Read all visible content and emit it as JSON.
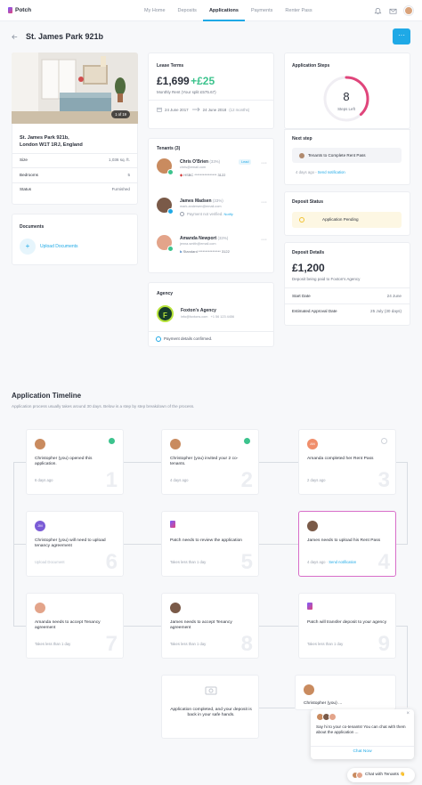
{
  "app": {
    "name": "Potch"
  },
  "nav": {
    "items": [
      "My Home",
      "Deposits",
      "Applications",
      "Payments",
      "Renter Pass"
    ],
    "active": "Applications"
  },
  "colors": {
    "accent": "#1fa9e6",
    "success": "#3cc38d",
    "highlight": "#d86ec9",
    "brand_gradient": [
      "#7b5cff",
      "#e0457b"
    ]
  },
  "page": {
    "back_icon": "arrow-left-icon",
    "title": "St. James Park 921b",
    "more_label": "···"
  },
  "property": {
    "photo_count": "1 of 19",
    "address_line1": "St. James Park 921b,",
    "address_line2": "London W1T 1RJ, England",
    "rows": [
      {
        "key": "Size",
        "value": "1,036 sq. ft."
      },
      {
        "key": "Bedrooms",
        "value": "5"
      },
      {
        "key": "Status",
        "value": "Furnished"
      }
    ]
  },
  "documents": {
    "title": "Documents",
    "upload_label": "Upload Documents",
    "plus": "+"
  },
  "lease": {
    "title": "Lease Terms",
    "rent": "£1,699",
    "share": "+£25",
    "rent_note": "Monthly Rent (Your split £575.67)",
    "start_date": "24 June 2017",
    "end_date": "24 June 2018",
    "end_suffix": "(12 months)"
  },
  "tenants": {
    "title": "Tenants (3)",
    "list": [
      {
        "name": "Chris O'Brien",
        "share": "(33%)",
        "badge": "Lead",
        "email": "chris@email.com",
        "bank": "HSBC **************** 3122"
      },
      {
        "name": "James Madsen",
        "share": "(33%)",
        "email": "mark.andersen@email.com",
        "bank_status": "Payment not verified.",
        "bank_action": "Notify"
      },
      {
        "name": "Amanda Newport",
        "share": "(33%)",
        "email": "jenna.smith@email.com",
        "bank": "Standard **************** 3122"
      }
    ]
  },
  "agency": {
    "title": "Agency",
    "logo_letter": "F",
    "name": "Foxton's Agency",
    "email": "info@foxtons.com",
    "phone": "+1 56 123 4456",
    "confirmed": "Payment details confirmed."
  },
  "steps": {
    "title": "Application Steps",
    "count": "8",
    "sub": "Steps Left",
    "progress": 0.38
  },
  "next_step": {
    "title": "Next step",
    "task": "Tenants to Complete Rent Pass",
    "ago": "4 days ago",
    "action": "Send notification"
  },
  "deposit_status": {
    "title": "Deposit Status",
    "status": "Application Pending"
  },
  "deposit_details": {
    "title": "Deposit Details",
    "amount": "£1,200",
    "note": "Deposit being paid to Foxton's Agency",
    "rows": [
      {
        "key": "Start Date",
        "value": "24 June"
      },
      {
        "key": "Estimated Approval Date",
        "value": "25 July (30 days)"
      }
    ]
  },
  "timeline": {
    "title": "Application Timeline",
    "subtitle": "Application process usually takes around 30 days. Below is a step by step breakdown of the process.",
    "items": [
      {
        "num": "1",
        "text": "Christopher (you) opened this application.",
        "meta": "6 days ago",
        "state": "done"
      },
      {
        "num": "2",
        "text": "Christopher (you) invited your 2 co-tenants.",
        "meta": "4 days ago",
        "state": "done"
      },
      {
        "num": "3",
        "text": "Amanda completed her Rent Pass",
        "meta": "2 days ago",
        "state": "pending",
        "initials": "AN"
      },
      {
        "num": "6",
        "text": "Christopher (you) will need to upload tenancy agreement",
        "meta": "Upload Document",
        "initials": "JM"
      },
      {
        "num": "5",
        "text": "Patch needs to review the application",
        "meta": "Takes less than 1 day"
      },
      {
        "num": "4",
        "text": "James needs to upload his Rent Pass",
        "meta": "4 days ago",
        "action": "Send notification"
      },
      {
        "num": "7",
        "text": "Amanda needs to accept Tenancy agreement",
        "meta": "Takes less than 1 day"
      },
      {
        "num": "8",
        "text": "James needs to accept Tenancy agreement",
        "meta": "Takes less than 1 day"
      },
      {
        "num": "9",
        "text": "Patch will transfer deposit to your agency",
        "meta": "Takes less than 1 day"
      },
      {
        "text": "Application completed, and your deposit is back in your safe hands."
      },
      {
        "text": "Christopher (you) ..."
      }
    ]
  },
  "chat": {
    "message": "Say hi to your co-tenants! You can chat with them about the application ...",
    "cta": "Chat Now",
    "button": "Chat with Tenants 👋",
    "close": "×"
  }
}
